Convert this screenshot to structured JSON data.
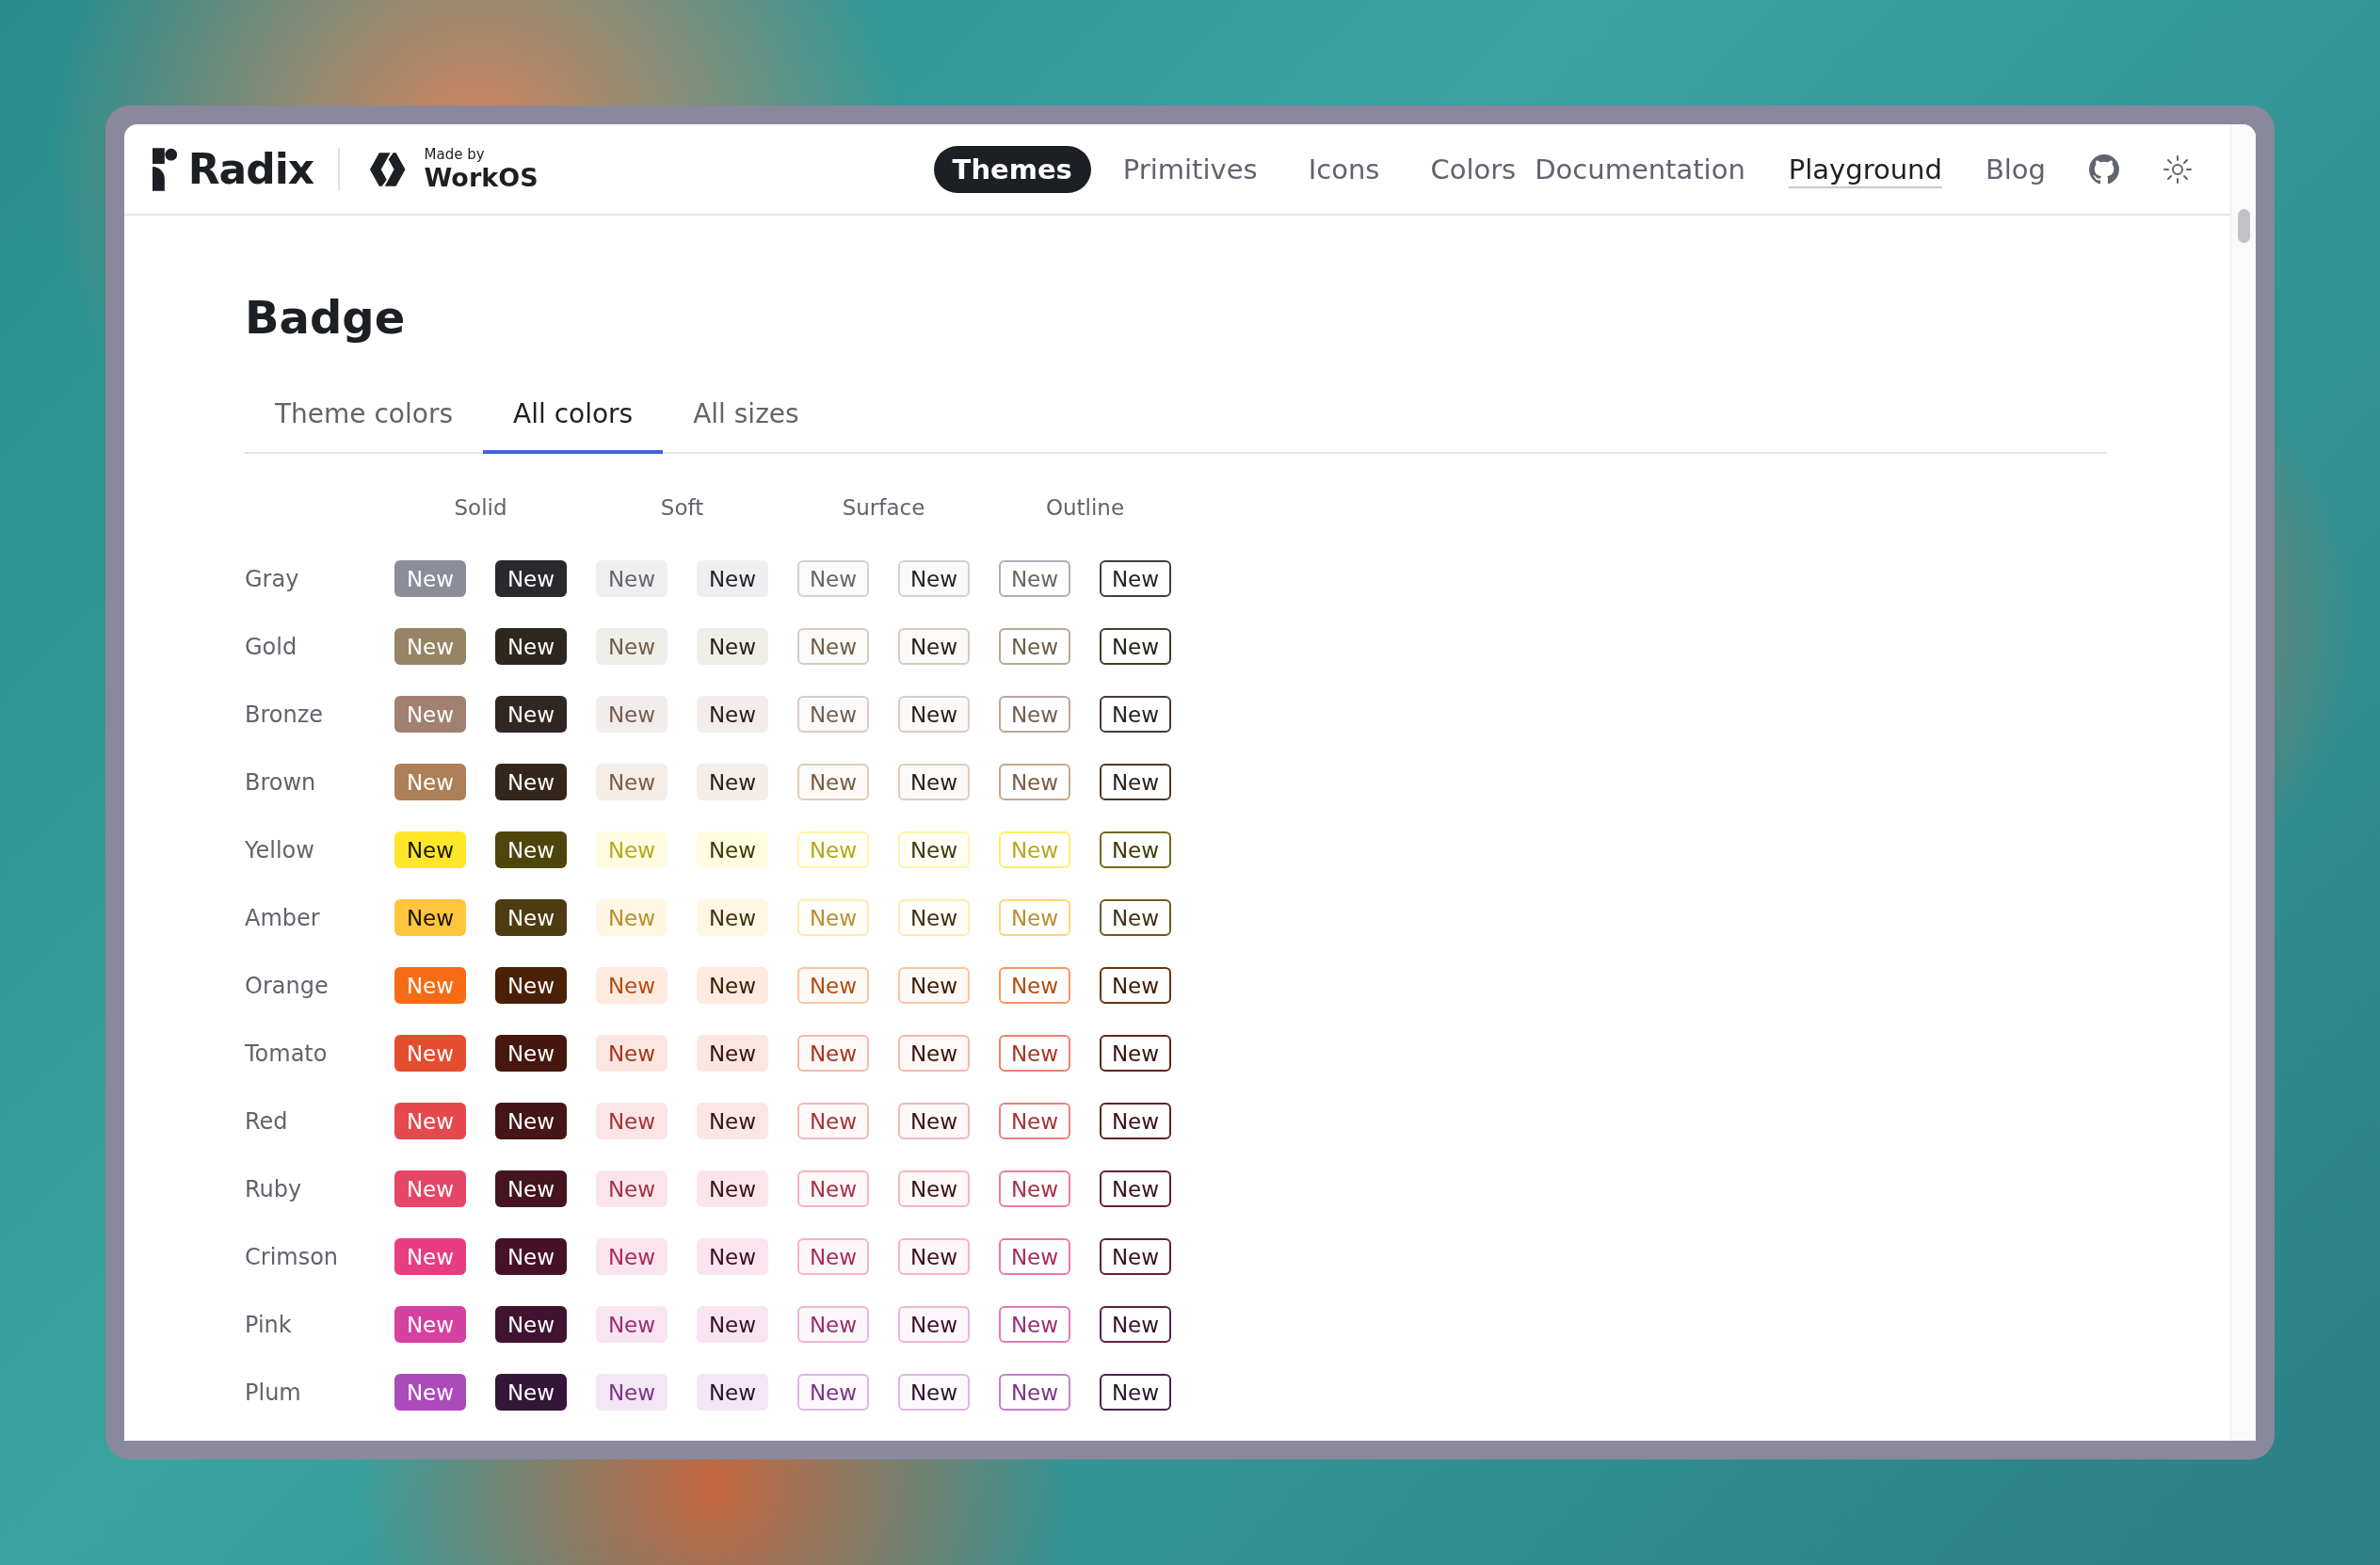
{
  "header": {
    "logo": "Radix",
    "made_by": "Made by",
    "partner": "WorkOS",
    "nav": [
      {
        "label": "Themes",
        "selected": true
      },
      {
        "label": "Primitives",
        "selected": false
      },
      {
        "label": "Icons",
        "selected": false
      },
      {
        "label": "Colors",
        "selected": false
      }
    ],
    "links": [
      {
        "label": "Documentation",
        "underlined": false
      },
      {
        "label": "Playground",
        "underlined": true
      },
      {
        "label": "Blog",
        "underlined": false
      }
    ]
  },
  "title": "Badge",
  "tabs": [
    {
      "label": "Theme colors",
      "selected": false
    },
    {
      "label": "All colors",
      "selected": true
    },
    {
      "label": "All sizes",
      "selected": false
    }
  ],
  "variants": [
    {
      "label": "Solid",
      "kind": "solid"
    },
    {
      "label": "Soft",
      "kind": "soft"
    },
    {
      "label": "Surface",
      "kind": "surface"
    },
    {
      "label": "Outline",
      "kind": "outline"
    }
  ],
  "rows": [
    {
      "label": "Gray",
      "color": "#8b8d98",
      "badges": [
        "New",
        "New",
        "New",
        "New",
        "New",
        "New",
        "New",
        "New"
      ]
    },
    {
      "label": "Gold",
      "color": "#978365",
      "badges": [
        "New",
        "New",
        "New",
        "New",
        "New",
        "New",
        "New",
        "New"
      ]
    },
    {
      "label": "Bronze",
      "color": "#a18072",
      "badges": [
        "New",
        "New",
        "New",
        "New",
        "New",
        "New",
        "New",
        "New"
      ]
    },
    {
      "label": "Brown",
      "color": "#ad7f58",
      "badges": [
        "New",
        "New",
        "New",
        "New",
        "New",
        "New",
        "New",
        "New"
      ]
    },
    {
      "label": "Yellow",
      "color": "#ffe629",
      "badges": [
        "New",
        "New",
        "New",
        "New",
        "New",
        "New",
        "New",
        "New"
      ]
    },
    {
      "label": "Amber",
      "color": "#ffc53d",
      "badges": [
        "New",
        "New",
        "New",
        "New",
        "New",
        "New",
        "New",
        "New"
      ]
    },
    {
      "label": "Orange",
      "color": "#f76b15",
      "badges": [
        "New",
        "New",
        "New",
        "New",
        "New",
        "New",
        "New",
        "New"
      ]
    },
    {
      "label": "Tomato",
      "color": "#e54d2e",
      "badges": [
        "New",
        "New",
        "New",
        "New",
        "New",
        "New",
        "New",
        "New"
      ]
    },
    {
      "label": "Red",
      "color": "#e5484d",
      "badges": [
        "New",
        "New",
        "New",
        "New",
        "New",
        "New",
        "New",
        "New"
      ]
    },
    {
      "label": "Ruby",
      "color": "#e54666",
      "badges": [
        "New",
        "New",
        "New",
        "New",
        "New",
        "New",
        "New",
        "New"
      ]
    },
    {
      "label": "Crimson",
      "color": "#e93d82",
      "badges": [
        "New",
        "New",
        "New",
        "New",
        "New",
        "New",
        "New",
        "New"
      ]
    },
    {
      "label": "Pink",
      "color": "#d6409f",
      "badges": [
        "New",
        "New",
        "New",
        "New",
        "New",
        "New",
        "New",
        "New"
      ]
    },
    {
      "label": "Plum",
      "color": "#ab4aba",
      "badges": [
        "New",
        "New",
        "New",
        "New",
        "New",
        "New",
        "New",
        "New"
      ]
    }
  ]
}
